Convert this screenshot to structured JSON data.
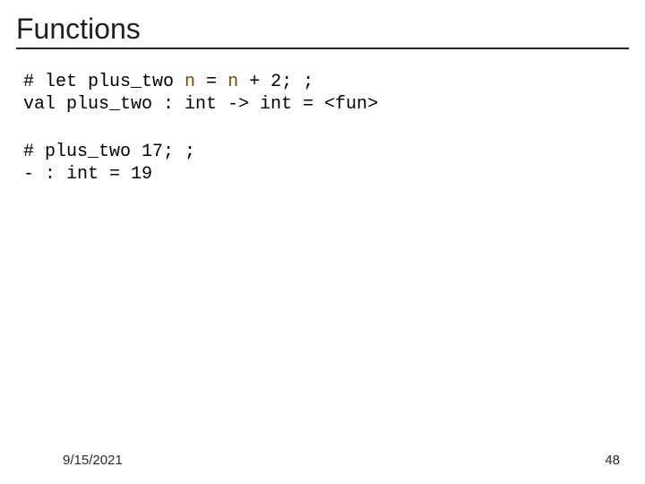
{
  "title": "Functions",
  "block1": {
    "p1": "# let plus_two ",
    "n1": "n",
    "p2": " = ",
    "n2": "n",
    "p3": " + 2; ;",
    "line2": "val plus_two : int -> int = <fun>"
  },
  "block2": {
    "line1": "# plus_two 17; ;",
    "line2": "- : int = 19"
  },
  "footer": {
    "date": "9/15/2021",
    "page": "48"
  }
}
